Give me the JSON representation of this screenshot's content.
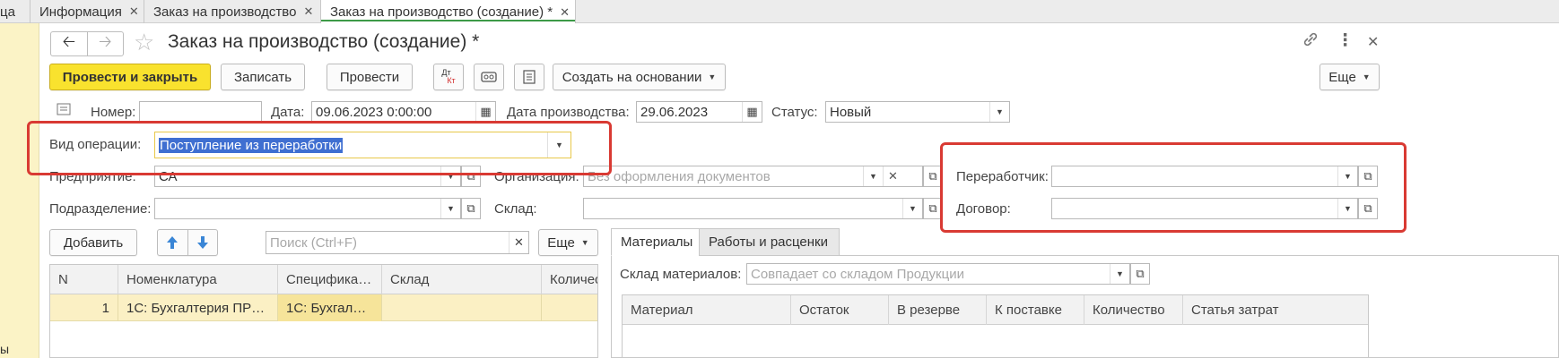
{
  "tabs": [
    {
      "label": "ца"
    },
    {
      "label": "Информация"
    },
    {
      "label": "Заказ на производство"
    },
    {
      "label": "Заказ на производство (создание) *"
    }
  ],
  "left_strip_text": "ы",
  "window": {
    "title": "Заказ на производство (создание) *"
  },
  "toolbar": {
    "post_close": "Провести и закрыть",
    "save": "Записать",
    "post": "Провести",
    "dtkt_dt": "Дт",
    "dtkt_kt": "Кт",
    "create_based": "Создать на основании",
    "more": "Еще"
  },
  "fields": {
    "number_label": "Номер:",
    "number_value": "",
    "date_label": "Дата:",
    "date_value": "09.06.2023  0:00:00",
    "prod_date_label": "Дата производства:",
    "prod_date_value": "29.06.2023",
    "status_label": "Статус:",
    "status_value": "Новый",
    "operation_label": "Вид операции:",
    "operation_value": "Поступление из переработки",
    "enterprise_label": "Предприятие:",
    "enterprise_value": "СА",
    "organization_label": "Организация:",
    "organization_placeholder": "Без оформления документов",
    "processor_label": "Переработчик:",
    "processor_value": "",
    "department_label": "Подразделение:",
    "department_value": "",
    "warehouse_label": "Склад:",
    "warehouse_value": "",
    "contract_label": "Договор:",
    "contract_value": ""
  },
  "products": {
    "add_button": "Добавить",
    "search_placeholder": "Поиск (Ctrl+F)",
    "more": "Еще",
    "columns": [
      "N",
      "Номенклатура",
      "Специфика…",
      "Склад",
      "Количес"
    ],
    "rows": [
      {
        "n": "1",
        "nomenclature": "1С: Бухгалтерия ПР…",
        "spec": "1С: Бухгал…",
        "warehouse": "",
        "qty": ""
      }
    ]
  },
  "right_panel": {
    "tabs": [
      "Материалы",
      "Работы и расценки"
    ],
    "materials_warehouse_label": "Склад материалов:",
    "materials_warehouse_placeholder": "Совпадает со складом Продукции",
    "columns": [
      "Материал",
      "Остаток",
      "В резерве",
      "К поставке",
      "Количество",
      "Статья затрат"
    ]
  },
  "colors": {
    "primary_button": "#f9e22e",
    "highlight_frame": "#d93a33",
    "selection": "#3f6fd1",
    "row_highlight": "#fbf0c4",
    "active_tab_underline": "#3c9a47"
  }
}
